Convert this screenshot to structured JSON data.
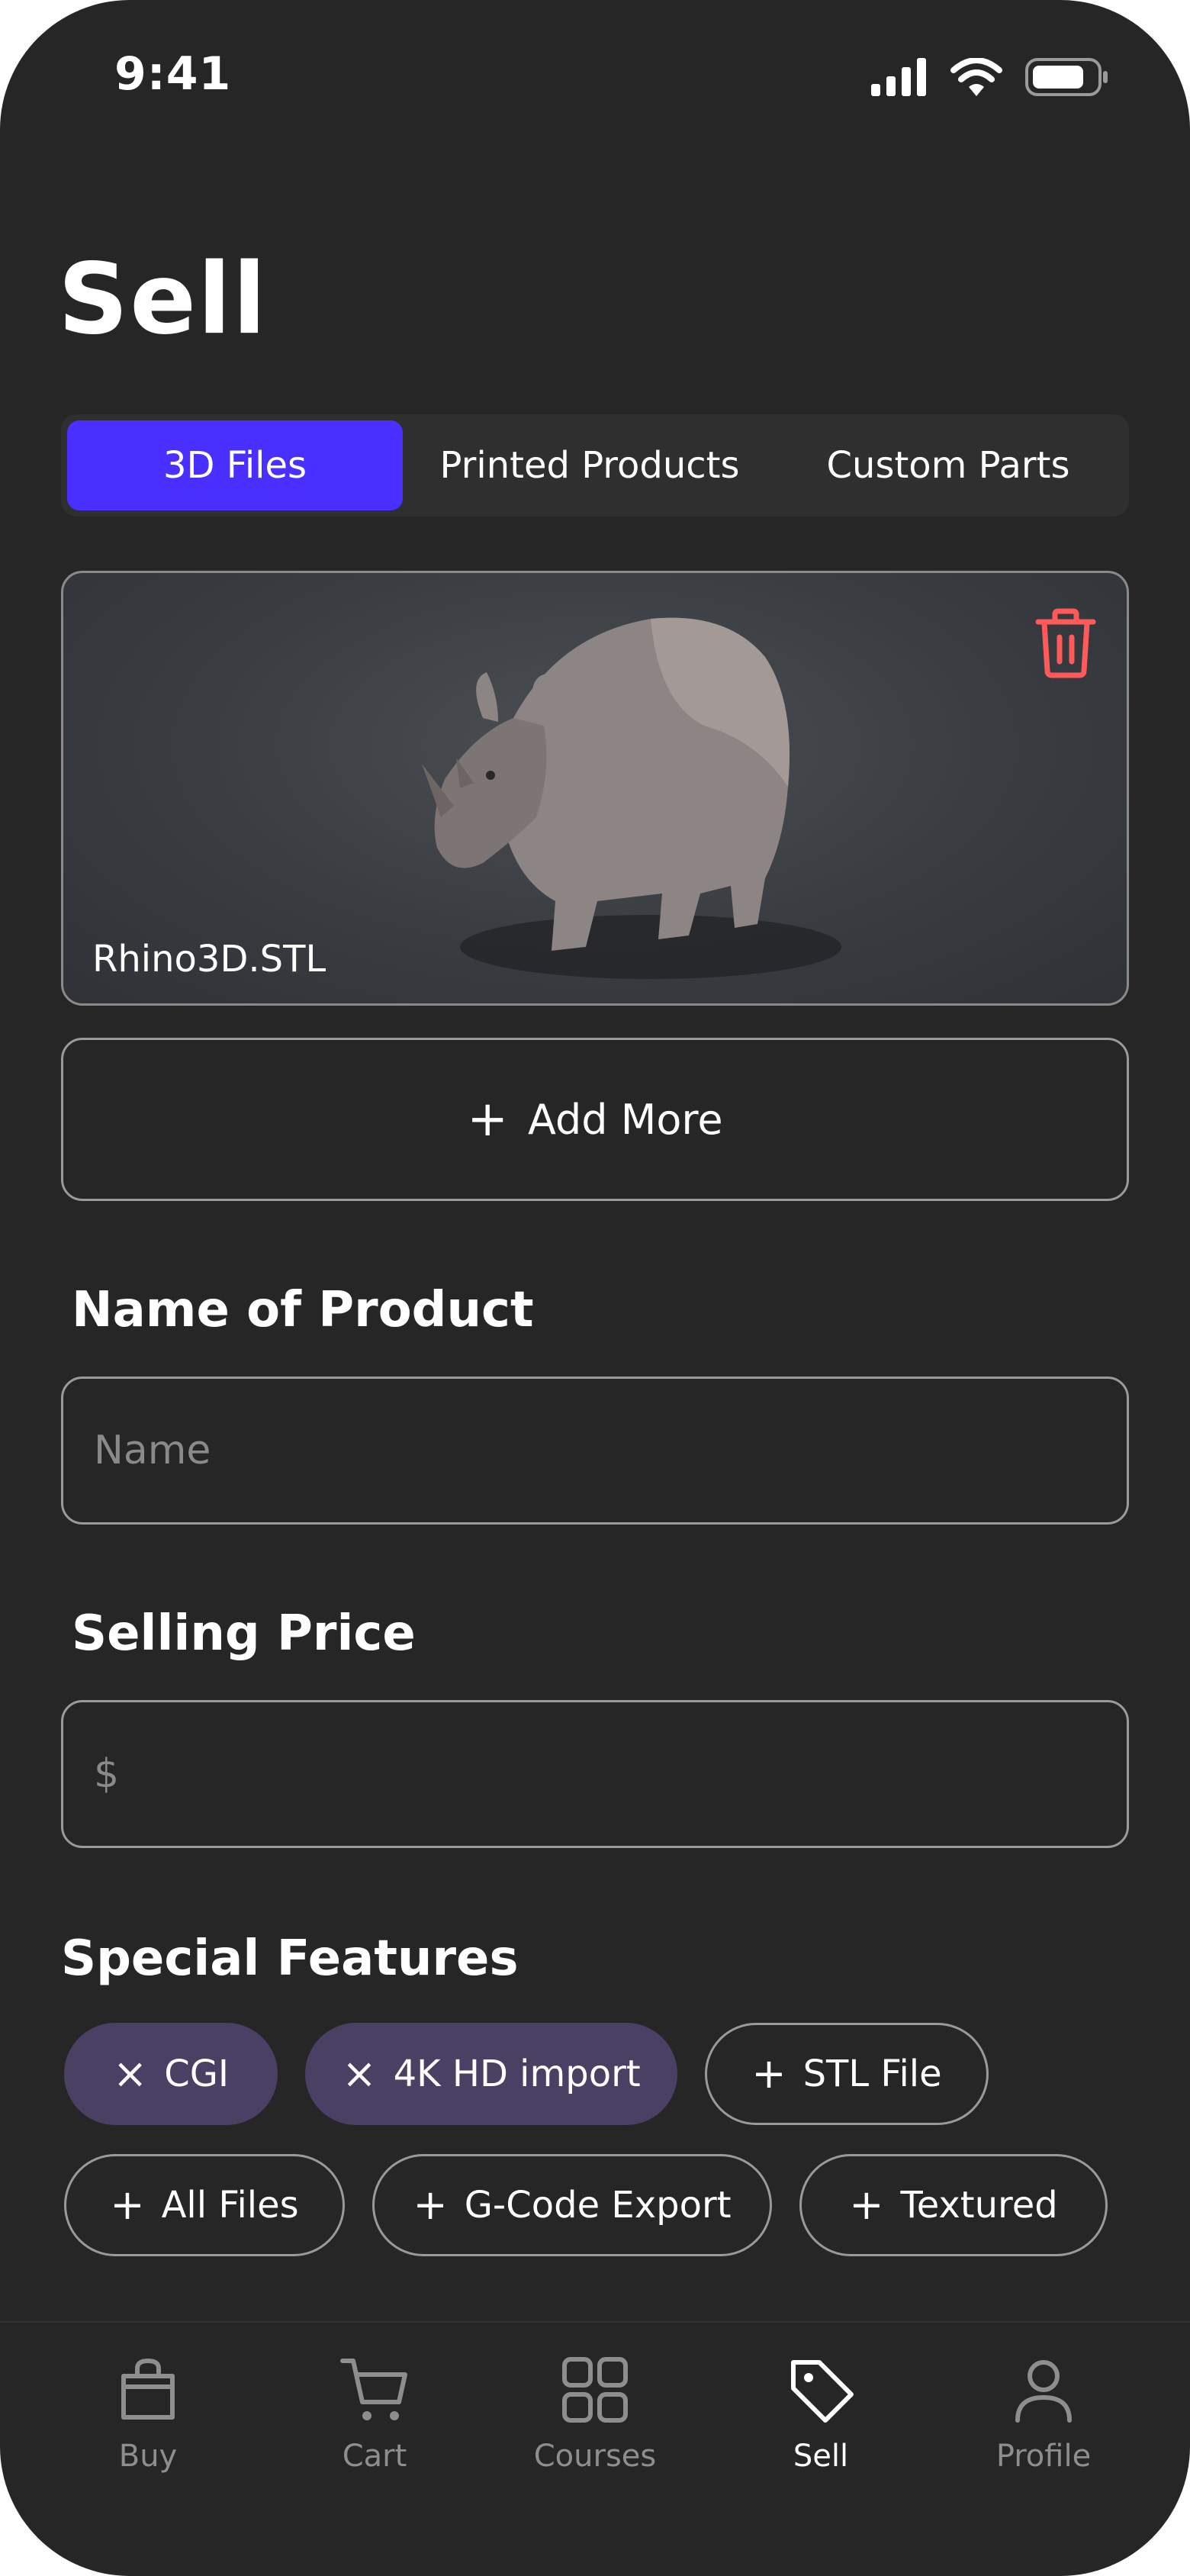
{
  "status": {
    "time": "9:41"
  },
  "page": {
    "title": "Sell"
  },
  "tabs": [
    {
      "label": "3D Files",
      "active": true
    },
    {
      "label": "Printed Products",
      "active": false
    },
    {
      "label": "Custom Parts",
      "active": false
    }
  ],
  "file_card": {
    "file_name": "Rhino3D.STL",
    "delete_icon": "trash-icon"
  },
  "add_more": {
    "label": "Add More"
  },
  "name_field": {
    "label": "Name of Product",
    "placeholder": "Name",
    "value": ""
  },
  "price_field": {
    "label": "Selling Price",
    "placeholder": "$",
    "value": ""
  },
  "features": {
    "label": "Special Features",
    "chips": [
      {
        "label": "CGI",
        "selected": true
      },
      {
        "label": "4K HD import",
        "selected": true
      },
      {
        "label": "STL File",
        "selected": false
      },
      {
        "label": "All Files",
        "selected": false
      },
      {
        "label": "G-Code Export",
        "selected": false
      },
      {
        "label": "Textured",
        "selected": false
      }
    ]
  },
  "nav": [
    {
      "label": "Buy",
      "icon": "shopping-bag-icon",
      "active": false
    },
    {
      "label": "Cart",
      "icon": "cart-icon",
      "active": false
    },
    {
      "label": "Courses",
      "icon": "grid-icon",
      "active": false
    },
    {
      "label": "Sell",
      "icon": "tag-icon",
      "active": true
    },
    {
      "label": "Profile",
      "icon": "user-icon",
      "active": false
    }
  ],
  "colors": {
    "background": "#262626",
    "accent": "#4a30ff",
    "chip_selected": "#4a4064",
    "delete": "#ff5a5a"
  }
}
